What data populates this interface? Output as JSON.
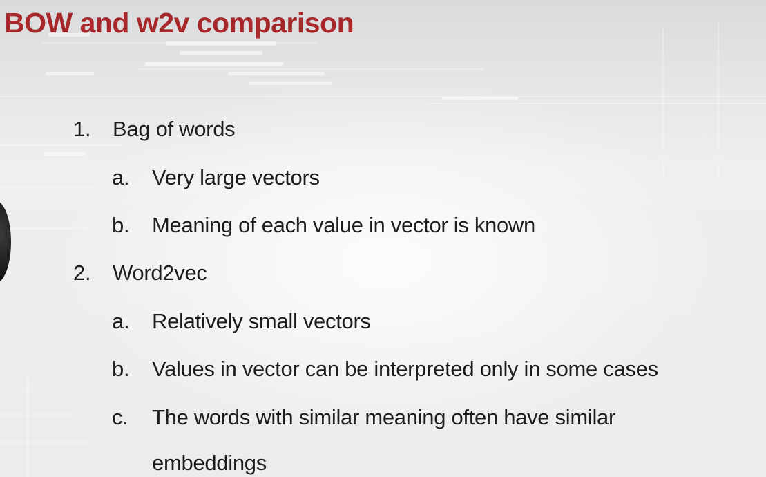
{
  "slide": {
    "title": "BOW and w2v comparison",
    "title_color": "#a8272a",
    "text_color": "#1d1d1d",
    "items": [
      {
        "marker": "1.",
        "text": "Bag of words"
      },
      {
        "marker": "a.",
        "text": "Very large vectors"
      },
      {
        "marker": "b.",
        "text": "Meaning of each value in vector is known"
      },
      {
        "marker": "2.",
        "text": "Word2vec"
      },
      {
        "marker": "a.",
        "text": "Relatively small vectors"
      },
      {
        "marker": "b.",
        "text": "Values in vector can be interpreted only in some cases"
      },
      {
        "marker": "c.",
        "text": "The words with similar meaning often have similar"
      },
      {
        "marker": "",
        "text": "embeddings"
      }
    ]
  }
}
